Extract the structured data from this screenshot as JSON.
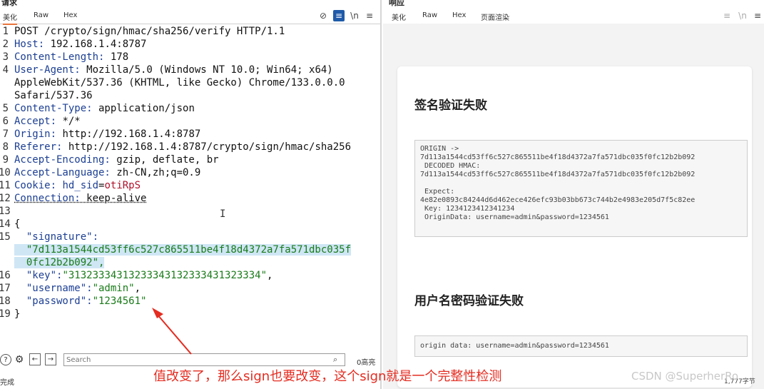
{
  "request": {
    "title": "请求",
    "tabs": [
      "美化",
      "Raw",
      "Hex"
    ],
    "active_tab": "美化",
    "lines": [
      {
        "n": "1",
        "k": "",
        "v": "POST /crypto/sign/hmac/sha256/verify HTTP/1.1"
      },
      {
        "n": "2",
        "k": "Host:",
        "v": " 192.168.1.4:8787"
      },
      {
        "n": "3",
        "k": "Content-Length:",
        "v": " 178"
      },
      {
        "n": "4",
        "k": "User-Agent:",
        "v": " Mozilla/5.0 (Windows NT 10.0; Win64; x64)"
      },
      {
        "n": "",
        "k": "",
        "v": "AppleWebKit/537.36 (KHTML, like Gecko) Chrome/133.0.0.0"
      },
      {
        "n": "",
        "k": "",
        "v": "Safari/537.36"
      },
      {
        "n": "5",
        "k": "Content-Type:",
        "v": " application/json"
      },
      {
        "n": "6",
        "k": "Accept:",
        "v": " */*"
      },
      {
        "n": "7",
        "k": "Origin:",
        "v": " http://192.168.1.4:8787"
      },
      {
        "n": "8",
        "k": "Referer:",
        "v": " http://192.168.1.4:8787/crypto/sign/hmac/sha256"
      },
      {
        "n": "9",
        "k": "Accept-Encoding:",
        "v": " gzip, deflate, br"
      },
      {
        "n": "10",
        "k": "Accept-Language:",
        "v": " zh-CN,zh;q=0.9"
      }
    ],
    "cookie": {
      "n": "11",
      "k": "Cookie:",
      "name": " hd_sid",
      "eq": "=",
      "val": "otiRpS"
    },
    "connection": {
      "n": "12",
      "k": "Connection:",
      "v": " keep-alive"
    },
    "blank": {
      "n": "13"
    },
    "json_open": {
      "n": "14",
      "v": "{"
    },
    "sig_key": {
      "n": "15",
      "v": "  \"signature\":"
    },
    "sig_val_1": "  \"7d113a1544cd53ff6c527c865511be4f18d4372a7fa571dbc035f",
    "sig_val_2": "  0fc12b2b092\",",
    "key_line": {
      "n": "16",
      "k": "  \"key\":",
      "v": "\"31323334313233343132333431323334\"",
      "tail": ","
    },
    "user_line": {
      "n": "17",
      "k": "  \"username\":",
      "v": "\"admin\"",
      "tail": ","
    },
    "pass_line": {
      "n": "18",
      "k": "  \"password\":",
      "v": "\"1234561\""
    },
    "json_close": {
      "n": "19",
      "v": "}"
    },
    "search_placeholder": "Search",
    "match_count": "0高亮",
    "status": "完成"
  },
  "response": {
    "title": "响应",
    "tabs": [
      "美化",
      "Raw",
      "Hex",
      "页面渲染"
    ],
    "active_tab": "页面渲染",
    "heading1": "签名验证失败",
    "box1": "ORIGIN ->\n7d113a1544cd53ff6c527c865511be4f18d4372a7fa571dbc035f0fc12b2b092\n DECODED HMAC:\n7d113a1544cd53ff6c527c865511be4f18d4372a7fa571dbc035f0fc12b2b092\n\n Expect:\n4e82e0893c84244d6d462ece426efc93b03bb673c744b2e4983e205d7f5c82ee\n Key: 1234123412341234\n OriginData: username=admin&password=1234561",
    "heading2": "用户名密码验证失败",
    "box2": "origin data: username=admin&password=1234561",
    "byte_count": "1,777字节"
  },
  "annotation": "值改变了，那么sign也要改变，这个sign就是一个完整性检测",
  "watermark": "CSDN @SuperherRo",
  "colors": {
    "annotation": "#e42c20",
    "active_tab": "#e8743b",
    "selected_tool": "#1e5aa8"
  }
}
